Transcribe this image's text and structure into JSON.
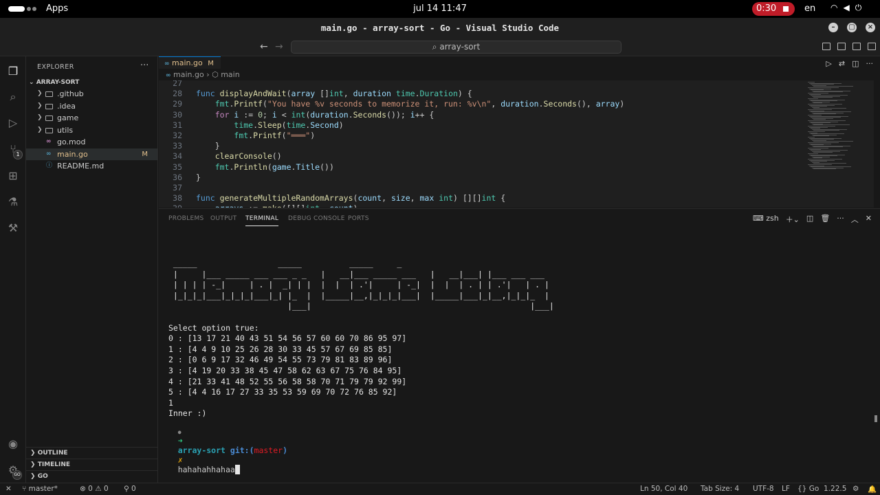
{
  "topbar": {
    "apps": "Apps",
    "clock": "jul 14 11:47",
    "record_time": "0:30",
    "lang": "en"
  },
  "window": {
    "title": "main.go - array-sort - Go - Visual Studio Code"
  },
  "command_center": {
    "label": "array-sort"
  },
  "activity": {
    "scm_badge": "1",
    "accounts_badge": "GO"
  },
  "sidebar": {
    "title": "EXPLORER",
    "project": "ARRAY-SORT",
    "items": [
      {
        "name": ".github",
        "type": "folder"
      },
      {
        "name": ".idea",
        "type": "folder"
      },
      {
        "name": "game",
        "type": "folder"
      },
      {
        "name": "utils",
        "type": "folder"
      },
      {
        "name": "go.mod",
        "type": "gomod"
      },
      {
        "name": "main.go",
        "type": "go",
        "status": "M"
      },
      {
        "name": "README.md",
        "type": "md"
      }
    ],
    "outline": "OUTLINE",
    "timeline": "TIMELINE",
    "go": "GO"
  },
  "editor": {
    "tab": {
      "name": "main.go",
      "status": "M"
    },
    "breadcrumb": {
      "file": "main.go",
      "symbol": "main"
    },
    "lines": [
      {
        "n": "27",
        "html": ""
      },
      {
        "n": "28",
        "html": "<span class='kw'>func</span> <span class='fn'>displayAndWait</span>(<span class='vr'>array</span> []<span class='ty'>int</span>, <span class='vr'>duration</span> <span class='ty'>time</span>.<span class='ty'>Duration</span>) {"
      },
      {
        "n": "29",
        "html": "    <span class='ty'>fmt</span>.<span class='fnc'>Printf</span>(<span class='st'>\"You have %v seconds to memorize it, run: %v\\n\"</span>, <span class='vr'>duration</span>.<span class='fnc'>Seconds</span>(), <span class='vr'>array</span>)"
      },
      {
        "n": "30",
        "html": "    <span class='kc'>for</span> <span class='vr'>i</span> := <span class='nu'>0</span>; <span class='vr'>i</span> &lt; <span class='ty'>int</span>(<span class='vr'>duration</span>.<span class='fnc'>Seconds</span>()); <span class='vr'>i</span>++ {"
      },
      {
        "n": "31",
        "html": "        <span class='ty'>time</span>.<span class='fnc'>Sleep</span>(<span class='ty'>time</span>.<span class='vr'>Second</span>)"
      },
      {
        "n": "32",
        "html": "        <span class='ty'>fmt</span>.<span class='fnc'>Printf</span>(<span class='st'>\"═══\"</span>)"
      },
      {
        "n": "33",
        "html": "    }"
      },
      {
        "n": "34",
        "html": "    <span class='fnc'>clearConsole</span>()"
      },
      {
        "n": "35",
        "html": "    <span class='ty'>fmt</span>.<span class='fnc'>Println</span>(<span class='vr'>game</span>.<span class='vr'>Title</span>())"
      },
      {
        "n": "36",
        "html": "}"
      },
      {
        "n": "37",
        "html": ""
      },
      {
        "n": "38",
        "html": "<span class='kw'>func</span> <span class='fn'>generateMultipleRandomArrays</span>(<span class='vr'>count</span>, <span class='vr'>size</span>, <span class='vr'>max</span> <span class='ty'>int</span>) [][]<span class='ty'>int</span> {"
      },
      {
        "n": "39",
        "html": "    <span class='vr'>arrays</span> := <span class='fnc'>make</span>([][]<span class='ty'>int</span>, <span class='vr'>count</span>)"
      }
    ]
  },
  "panel": {
    "tabs": [
      "PROBLEMS",
      "OUTPUT",
      "TERMINAL",
      "DEBUG CONSOLE",
      "PORTS"
    ],
    "active_tab": "TERMINAL",
    "shell": "zsh",
    "terminal_lines": [
      " _____                 _____          _____     _",
      " |     |___ _____ ___ ___ _ _   |   __|___ _____ ___   |   __|___| |___ ___ ___",
      " | | | | -_|     | . |  _| | |  |  |  | .'|     | -_|  |  |  | . | | .'|   | . |",
      " |_|_|_|___|_|_|_|___|_| |_  |  |_____|__,|_|_|_|___|  |_____|___|_|__,|_|_|_  |",
      "                         |___|                                              |___|",
      "",
      "Select option true:",
      "0 : [13 17 21 40 43 51 54 56 57 60 60 70 86 95 97]",
      "1 : [4 4 9 10 25 26 28 30 33 45 57 67 69 85 85]",
      "2 : [0 6 9 17 32 46 49 54 55 73 79 81 83 89 96]",
      "3 : [4 19 20 33 38 45 47 58 62 63 67 75 76 84 95]",
      "4 : [21 33 41 48 52 55 56 58 58 70 71 79 79 92 99]",
      "5 : [4 4 16 17 27 33 35 53 59 69 70 72 76 85 92]",
      "1",
      "Inner :)"
    ],
    "prompt": {
      "dir": "array-sort",
      "git": "git:(",
      "branch": "master",
      "git_close": ")",
      "x": "✗",
      "input": "hahahahhahaa"
    }
  },
  "statusbar": {
    "branch": "master*",
    "errors": "0",
    "warnings": "0",
    "ports": "0",
    "position": "Ln 50, Col 40",
    "tab_size": "Tab Size: 4",
    "encoding": "UTF-8",
    "eol": "LF",
    "language": "Go",
    "go_version": "1.22.5"
  }
}
